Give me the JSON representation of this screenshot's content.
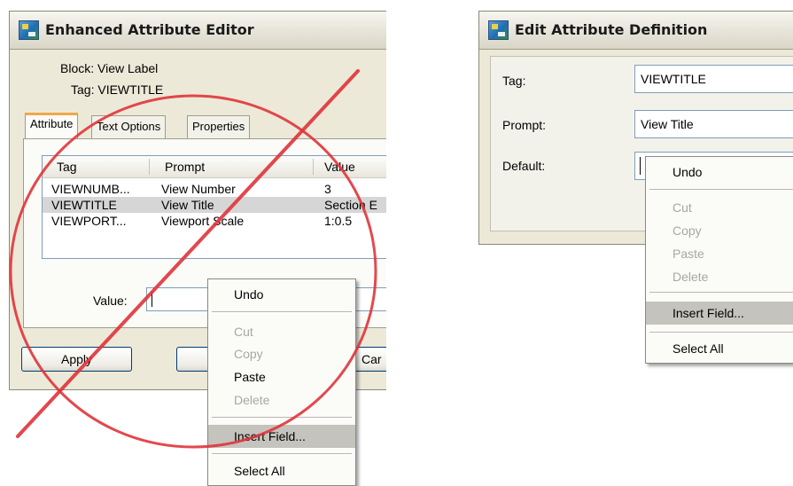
{
  "left_dialog": {
    "title": "Enhanced Attribute Editor",
    "block_line": "Block: View Label",
    "tag_line": "Tag: VIEWTITLE",
    "tabs": [
      {
        "label": "Attribute",
        "active": true
      },
      {
        "label": "Text Options",
        "active": false
      },
      {
        "label": "Properties",
        "active": false
      }
    ],
    "table": {
      "columns": [
        "Tag",
        "Prompt",
        "Value"
      ],
      "rows": [
        {
          "tag": "VIEWNUMB...",
          "prompt": "View Number",
          "value": "3",
          "selected": false
        },
        {
          "tag": "VIEWTITLE",
          "prompt": "View Title",
          "value": "Section E",
          "selected": true
        },
        {
          "tag": "VIEWPORT...",
          "prompt": "Viewport Scale",
          "value": "1:0.5",
          "selected": false
        }
      ]
    },
    "value_label": "Value:",
    "value_text": "",
    "buttons": {
      "apply": "Apply",
      "ok": "",
      "cancel": "Car"
    }
  },
  "left_menu": {
    "items": [
      {
        "label": "Undo",
        "enabled": true
      },
      {
        "separator": true
      },
      {
        "label": "Cut",
        "enabled": false
      },
      {
        "label": "Copy",
        "enabled": false
      },
      {
        "label": "Paste",
        "enabled": true
      },
      {
        "label": "Delete",
        "enabled": false
      },
      {
        "separator": true
      },
      {
        "label": "Insert Field...",
        "enabled": true,
        "highlighted": true
      },
      {
        "separator": true
      },
      {
        "label": "Select All",
        "enabled": true
      }
    ]
  },
  "right_dialog": {
    "title": "Edit Attribute Definition",
    "fields": [
      {
        "label": "Tag:",
        "value": "VIEWTITLE"
      },
      {
        "label": "Prompt:",
        "value": "View Title"
      },
      {
        "label": "Default:",
        "value": ""
      }
    ]
  },
  "right_menu": {
    "items": [
      {
        "label": "Undo",
        "enabled": true
      },
      {
        "separator": true
      },
      {
        "label": "Cut",
        "enabled": false
      },
      {
        "label": "Copy",
        "enabled": false
      },
      {
        "label": "Paste",
        "enabled": false
      },
      {
        "label": "Delete",
        "enabled": false
      },
      {
        "separator": true
      },
      {
        "label": "Insert Field...",
        "enabled": true,
        "highlighted": true
      },
      {
        "separator": true
      },
      {
        "label": "Select All",
        "enabled": true
      }
    ]
  },
  "overlay": {
    "symbol": "prohibited-sign",
    "color": "#e0343a"
  },
  "colors": {
    "dialog_bg": "#ece9d8",
    "active_tab_accent": "#f0a848",
    "menu_highlight": "#c4c3bd",
    "disabled_text": "#a7a7a7"
  }
}
